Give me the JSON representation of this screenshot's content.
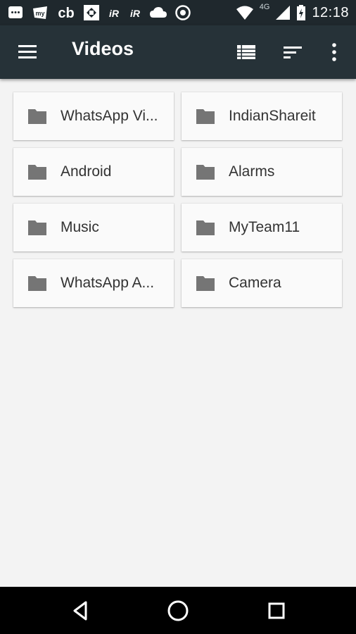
{
  "status_bar": {
    "time": "12:18",
    "network": "4G",
    "notification_icons": [
      "whatsapp-icon",
      "app-icon",
      "cb-icon",
      "app-icon",
      "app-icon",
      "app-icon",
      "cloud-icon",
      "sync-icon"
    ]
  },
  "toolbar": {
    "title": "Videos"
  },
  "folders": [
    {
      "name": "WhatsApp Vi..."
    },
    {
      "name": "IndianShareit"
    },
    {
      "name": "Android"
    },
    {
      "name": "Alarms"
    },
    {
      "name": "Music"
    },
    {
      "name": "MyTeam11"
    },
    {
      "name": "WhatsApp A..."
    },
    {
      "name": "Camera"
    }
  ],
  "colors": {
    "status_bar": "#1f282d",
    "toolbar": "#263238",
    "background": "#f3f3f3",
    "card": "#fafafa",
    "folder_icon": "#757575"
  }
}
